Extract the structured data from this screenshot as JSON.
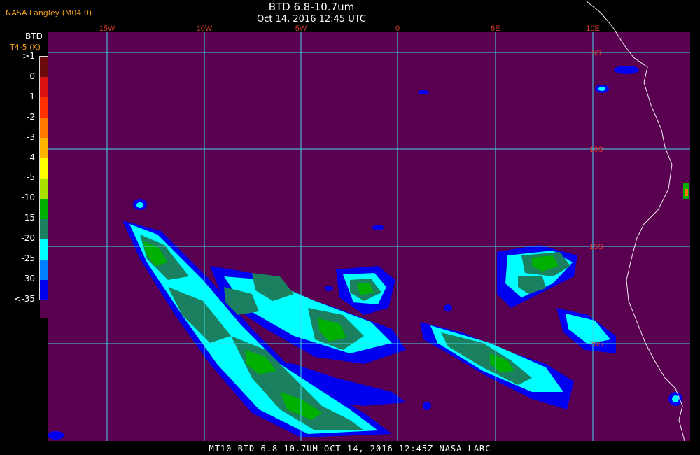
{
  "header": {
    "credit": "NASA Langley (M04.0)",
    "title": "BTD 6.8-10.7um",
    "subtitle": "Oct 14, 2016 12:45 UTC"
  },
  "legend": {
    "title": "BTD",
    "unit": "T4-5 (K)",
    "labels": [
      ">1",
      "0",
      "-1",
      "-2",
      "-3",
      "-4",
      "-5",
      "-10",
      "-15",
      "-20",
      "-25",
      "-30",
      "<-35"
    ],
    "colors": [
      "#6a0a0a",
      "#d81010",
      "#ff3000",
      "#ff7800",
      "#ffb400",
      "#ffff00",
      "#a8e000",
      "#00b000",
      "#1a8060",
      "#00ffff",
      "#0080ff",
      "#0000f0",
      "#5a0050"
    ]
  },
  "map": {
    "background": "#5a0050",
    "grid_color": "#40d8e8",
    "longitude_labels": [
      "15W",
      "10W",
      "5W",
      "0",
      "5E",
      "10E"
    ],
    "latitude_labels": [
      "5S",
      "10S",
      "15S",
      "20S"
    ]
  },
  "footer": "MT10  BTD 6.8-10.7UM  OCT 14, 2016 12:45Z  NASA LARC"
}
